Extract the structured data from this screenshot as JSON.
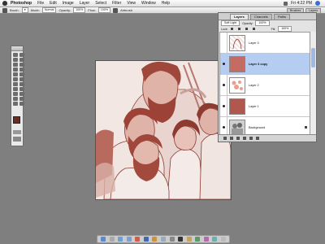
{
  "menubar": {
    "app": "Photoshop",
    "items": [
      "File",
      "Edit",
      "Image",
      "Layer",
      "Select",
      "Filter",
      "View",
      "Window",
      "Help"
    ],
    "clock": "Fri 4:22 PM"
  },
  "options": {
    "brush_label": "Brush:",
    "mode_label": "Mode:",
    "mode_value": "Normal",
    "opacity_label": "Opacity:",
    "opacity_value": "100%",
    "flow_label": "Flow:",
    "flow_value": "100%",
    "airbrush": "Airbrush",
    "wells": [
      "Brushes",
      "Layers"
    ]
  },
  "palette": {
    "tabs": [
      "Layers",
      "Channels",
      "Paths"
    ],
    "blend_mode": "Soft Light",
    "opacity_label": "Opacity:",
    "opacity_value": "100%",
    "lock_label": "Lock:",
    "fill_label": "Fill:",
    "fill_value": "100%",
    "layers": [
      {
        "name": "Layer 3",
        "visible": false,
        "thumb": "sketch",
        "selected": false
      },
      {
        "name": "Layer 3 copy",
        "visible": true,
        "thumb": "#c46c64",
        "selected": true
      },
      {
        "name": "Layer 2",
        "visible": true,
        "thumb": "blobs",
        "selected": false
      },
      {
        "name": "Layer 1",
        "visible": true,
        "thumb": "#b0584e",
        "selected": false
      },
      {
        "name": "Background",
        "visible": true,
        "thumb": "grey",
        "selected": false
      }
    ]
  },
  "colors": {
    "foreground": "#6e2a25",
    "tint": "#b3584b",
    "selection": "#b4cdf0"
  }
}
